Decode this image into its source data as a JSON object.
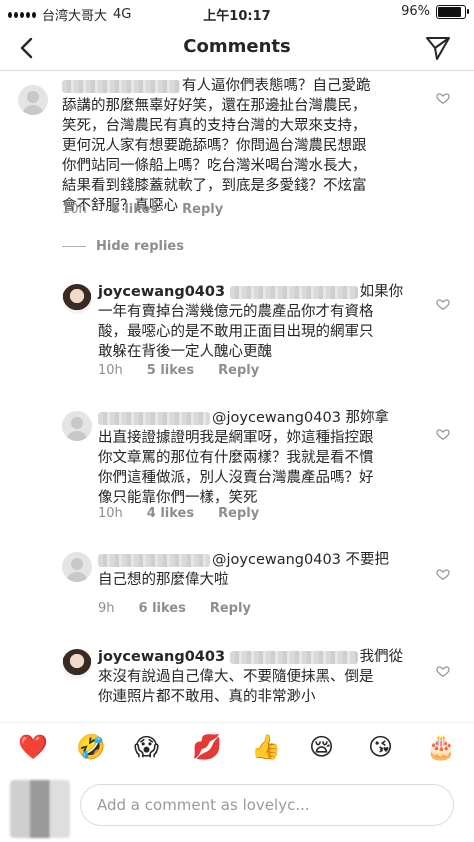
{
  "status_bar": {
    "carrier": "台湾大哥大",
    "network": "4G",
    "time": "上午10:17",
    "battery": "96%",
    "battery_level": 0.96
  },
  "nav": {
    "title": "Comments"
  },
  "comments": [
    {
      "lines": [
        "有人逼你們表態嗎？自己愛跪",
        "舔講的那麼無辜好好笑，還在那邊扯台灣農民，",
        "笑死，台灣農民有真的支持台灣的大眾來支持，",
        "更何況人家有想要跪舔嗎？你問過台灣農民想跟",
        "你們站同一條船上嗎？吃台灣米喝台灣水長大，",
        "結果看到錢膝蓋就軟了，到底是多愛錢？不炫富",
        "會不舒服？真噁心"
      ],
      "time": "10h",
      "likes": "8 likes",
      "reply": "Reply"
    }
  ],
  "hide_replies": "Hide replies",
  "replies": [
    {
      "username": "joycewang0403",
      "lines": [
        "如果你",
        "一年有賣掉台灣幾億元的農產品你才有資格",
        "酸，最噁心的是不敢用正面目出現的網軍只",
        "敢躲在背後一定人醜心更醜"
      ],
      "time": "10h",
      "likes": "5 likes",
      "reply": "Reply"
    },
    {
      "mention": "@joycewang0403",
      "lines": [
        "那妳拿",
        "出直接證據證明我是網軍呀，妳這種指控跟",
        "你文章罵的那位有什麼兩樣？我就是看不慣",
        "你們這種做派，別人沒賣台灣農產品嗎？好",
        "像只能靠你們一樣，笑死"
      ],
      "time": "10h",
      "likes": "4 likes",
      "reply": "Reply"
    },
    {
      "mention": "@joycewang0403",
      "lines": [
        "不要把",
        "自己想的那麼偉大啦"
      ],
      "time": "9h",
      "likes": "6 likes",
      "reply": "Reply"
    },
    {
      "username": "joycewang0403",
      "lines": [
        "我們從",
        "來沒有說過自己偉大、不要隨便抹黑、倒是",
        "你連照片都不敢用、真的非常渺小"
      ],
      "time": "",
      "likes": "",
      "reply": ""
    }
  ],
  "emoji_bar": [
    "❤️",
    "🤣",
    "😱",
    "💋",
    "👍",
    "😪",
    "😘",
    "🎂"
  ],
  "composer": {
    "placeholder": "Add a comment as lovelyc..."
  }
}
